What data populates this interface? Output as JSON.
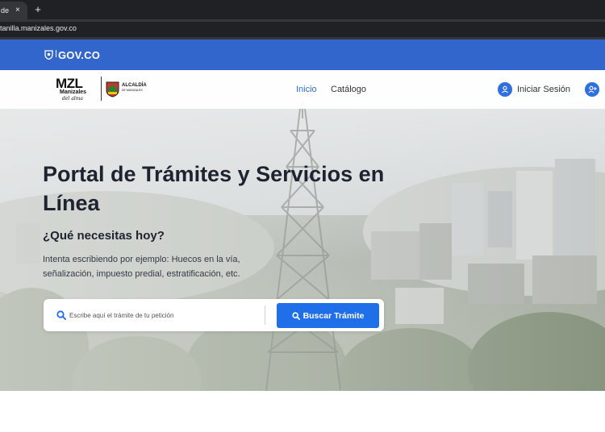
{
  "browser": {
    "tab_title": "de",
    "tab_close": "×",
    "new_tab": "+",
    "url": "tanilla.manizales.gov.co"
  },
  "govbar": {
    "logo_text": "GOV.CO",
    "color": "#3366cc"
  },
  "header": {
    "brand_main": "MZL",
    "brand_sub": "Manizales",
    "brand_script": "del alma",
    "alcaldia_line1": "ALCALDÍA",
    "alcaldia_line2": "DE MANIZALES",
    "nav": [
      {
        "label": "Inicio",
        "active": true
      },
      {
        "label": "Catálogo",
        "active": false
      }
    ],
    "login_label": "Iniciar Sesión",
    "login_icon": "user-icon",
    "register_icon": "user-plus-icon",
    "accent_color": "#2f6fe0"
  },
  "hero": {
    "title": "Portal de Trámites y Servicios en Línea",
    "question": "¿Qué necesitas hoy?",
    "hint": "Intenta escribiendo por ejemplo: Huecos en la vía, señalización, impuesto predial, estratificación, etc."
  },
  "search": {
    "placeholder": "Escribe aquí el trámite de tu petición",
    "button_label": "Buscar Trámite",
    "button_color": "#1f6fe8",
    "icon": "search-icon"
  }
}
